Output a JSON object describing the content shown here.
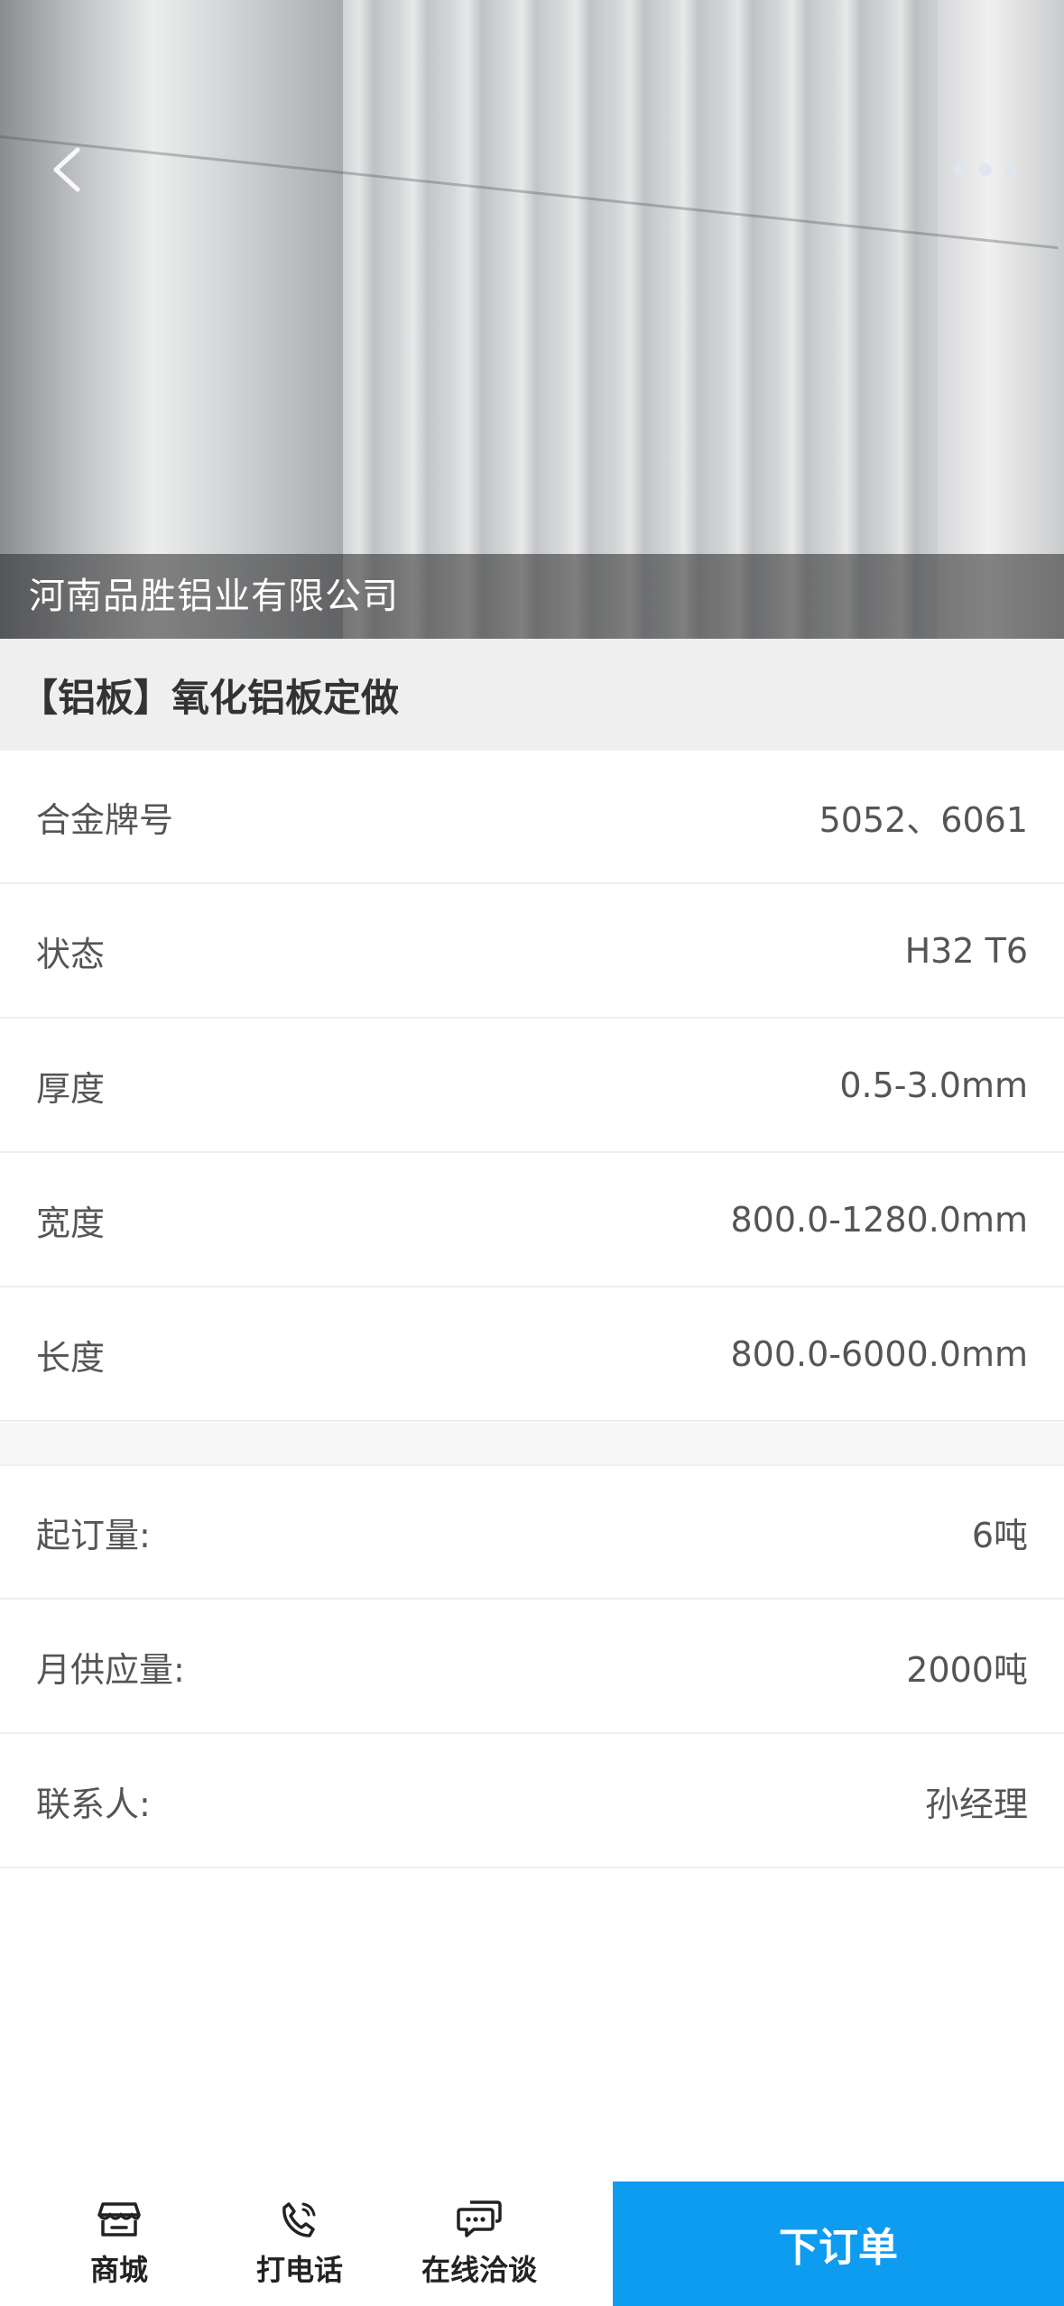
{
  "hero": {
    "company_name": "河南品胜铝业有限公司",
    "back_icon": "chevron-left-icon",
    "more_icon": "more-dots-icon"
  },
  "product": {
    "title": "【铝板】氧化铝板定做"
  },
  "specs": [
    {
      "label": "合金牌号",
      "value": "5052、6061"
    },
    {
      "label": "状态",
      "value": "H32 T6"
    },
    {
      "label": "厚度",
      "value": "0.5-3.0mm"
    },
    {
      "label": "宽度",
      "value": "800.0-1280.0mm"
    },
    {
      "label": "长度",
      "value": "800.0-6000.0mm"
    }
  ],
  "supply": [
    {
      "label": "起订量:",
      "value": "6吨"
    },
    {
      "label": "月供应量:",
      "value": "2000吨"
    },
    {
      "label": "联系人:",
      "value": "孙经理"
    }
  ],
  "bottom_bar": {
    "tabs": [
      {
        "label": "商城",
        "icon": "store-icon"
      },
      {
        "label": "打电话",
        "icon": "phone-icon"
      },
      {
        "label": "在线洽谈",
        "icon": "chat-icon"
      }
    ],
    "order_label": "下订单",
    "accent_color": "#0e9cf0"
  }
}
